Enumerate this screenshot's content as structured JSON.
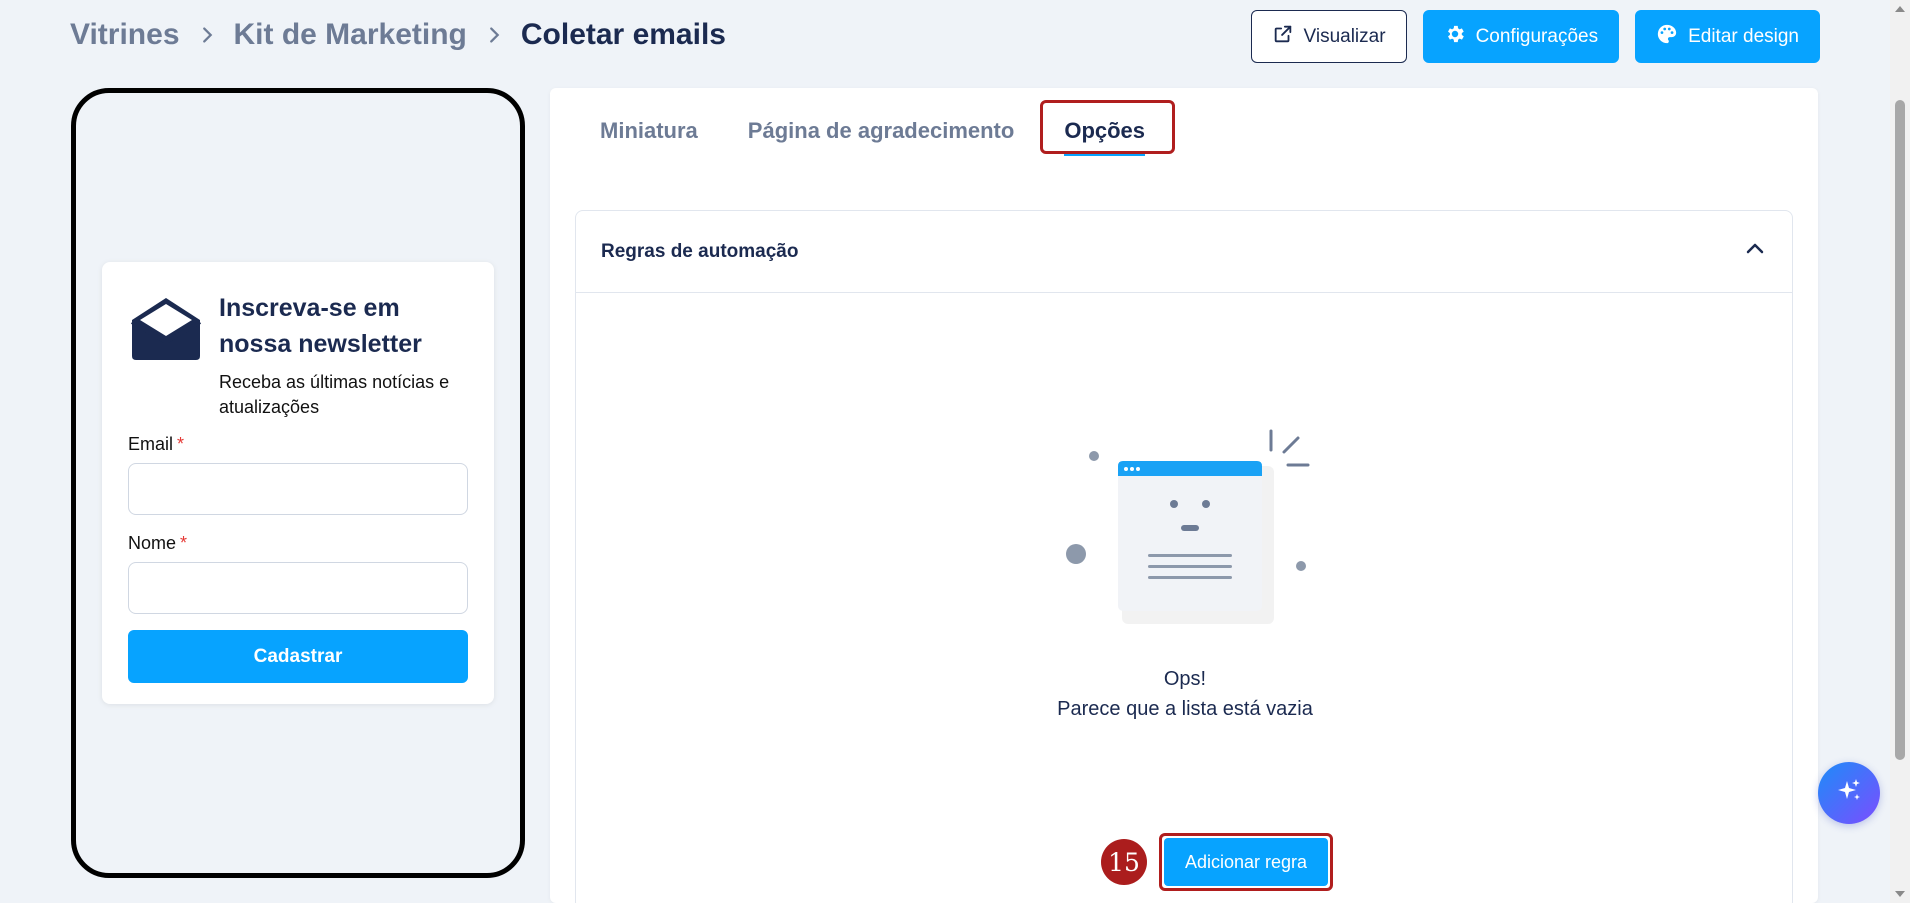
{
  "breadcrumb": {
    "items": [
      "Vitrines",
      "Kit de Marketing",
      "Coletar emails"
    ]
  },
  "header": {
    "preview_label": "Visualizar",
    "settings_label": "Configurações",
    "design_label": "Editar design"
  },
  "form": {
    "title": "Inscreva-se em nossa newsletter",
    "subtitle": "Receba as últimas notícias e atualizações",
    "email_label": "Email",
    "name_label": "Nome",
    "required_mark": "*",
    "submit_label": "Cadastrar",
    "email_value": "",
    "name_value": ""
  },
  "tabs": {
    "items": [
      "Miniatura",
      "Página de agradecimento",
      "Opções"
    ],
    "active": "Opções"
  },
  "accordion": {
    "title": "Regras de automação",
    "empty_title": "Ops!",
    "empty_message": "Parece que a lista está vazia",
    "add_rule_label": "Adicionar regra"
  },
  "annotation": {
    "step_number": "15"
  },
  "colors": {
    "primary": "#07a3ff",
    "navy": "#1b2a50",
    "muted": "#6d7b95",
    "highlight": "#b01e1e",
    "background": "#eff3f8"
  },
  "icons": {
    "preview": "external-link-icon",
    "settings": "gear-icon",
    "design": "palette-icon",
    "form": "envelope-open-icon",
    "accordion_toggle": "chevron-up-icon",
    "fab": "sparkle-icon"
  }
}
